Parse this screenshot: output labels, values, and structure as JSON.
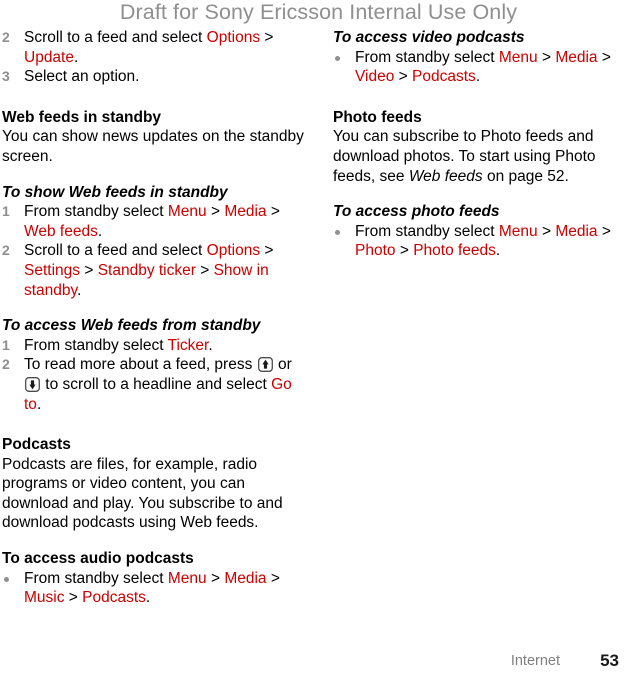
{
  "watermark": "Draft for Sony Ericsson Internal Use Only",
  "colors": {
    "ui_red": "#cc0000",
    "watermark_gray": "#8f8f8f",
    "marker_gray": "#8f8f8f",
    "footer_label_gray": "#808080",
    "body_black": "#000000"
  },
  "left_column": {
    "steps_continued": [
      {
        "number": "2",
        "parts": [
          {
            "text": "Scroll to a feed and select ",
            "style": "plain"
          },
          {
            "text": "Options",
            "style": "ui"
          },
          {
            "text": " > ",
            "style": "plain"
          },
          {
            "text": "Update",
            "style": "ui"
          },
          {
            "text": ".",
            "style": "plain"
          }
        ]
      },
      {
        "number": "3",
        "parts": [
          {
            "text": "Select an option.",
            "style": "plain"
          }
        ]
      }
    ],
    "section_web_feeds": {
      "heading": "Web feeds in standby",
      "body": "You can show news updates on the standby screen."
    },
    "task_show_web_feeds": {
      "heading": "To show Web feeds in standby",
      "steps": [
        {
          "number": "1",
          "parts": [
            {
              "text": "From standby select ",
              "style": "plain"
            },
            {
              "text": "Menu",
              "style": "ui"
            },
            {
              "text": " > ",
              "style": "plain"
            },
            {
              "text": "Media",
              "style": "ui"
            },
            {
              "text": " > ",
              "style": "plain"
            },
            {
              "text": "Web feeds",
              "style": "ui"
            },
            {
              "text": ".",
              "style": "plain"
            }
          ]
        },
        {
          "number": "2",
          "parts": [
            {
              "text": "Scroll to a feed and select ",
              "style": "plain"
            },
            {
              "text": "Options",
              "style": "ui"
            },
            {
              "text": " > ",
              "style": "plain"
            },
            {
              "text": "Settings",
              "style": "ui"
            },
            {
              "text": " > ",
              "style": "plain"
            },
            {
              "text": "Standby ticker",
              "style": "ui"
            },
            {
              "text": " > ",
              "style": "plain"
            },
            {
              "text": "Show in standby",
              "style": "ui"
            },
            {
              "text": ".",
              "style": "plain"
            }
          ]
        }
      ]
    },
    "task_access_web_feeds": {
      "heading": "To access Web feeds from standby",
      "step1": {
        "number": "1",
        "parts": [
          {
            "text": "From standby select ",
            "style": "plain"
          },
          {
            "text": "Ticker",
            "style": "ui"
          },
          {
            "text": ".",
            "style": "plain"
          }
        ]
      },
      "step2": {
        "number": "2",
        "text_a": "To read more about a feed, press ",
        "icon_up": "nav-key-up-icon",
        "text_b": " or ",
        "icon_down": "nav-key-down-icon",
        "text_c": " to scroll to a headline and select ",
        "link": "Go to",
        "text_d": "."
      }
    },
    "section_podcasts": {
      "heading": "Podcasts",
      "body": "Podcasts are files, for example, radio programs or video content, you can download and play. You subscribe to and download podcasts using Web feeds."
    },
    "task_audio_podcasts": {
      "heading": "To access audio podcasts",
      "bullet": {
        "parts": [
          {
            "text": "From standby select ",
            "style": "plain"
          },
          {
            "text": "Menu",
            "style": "ui"
          },
          {
            "text": " > ",
            "style": "plain"
          },
          {
            "text": "Media",
            "style": "ui"
          },
          {
            "text": " > ",
            "style": "plain"
          },
          {
            "text": "Music",
            "style": "ui"
          },
          {
            "text": " > ",
            "style": "plain"
          },
          {
            "text": "Podcasts",
            "style": "ui"
          },
          {
            "text": ".",
            "style": "plain"
          }
        ]
      }
    }
  },
  "right_column": {
    "task_video_podcasts": {
      "heading": "To access video podcasts",
      "bullet": {
        "parts": [
          {
            "text": "From standby select ",
            "style": "plain"
          },
          {
            "text": "Menu",
            "style": "ui"
          },
          {
            "text": " > ",
            "style": "plain"
          },
          {
            "text": "Media",
            "style": "ui"
          },
          {
            "text": " > ",
            "style": "plain"
          },
          {
            "text": "Video",
            "style": "ui"
          },
          {
            "text": " > ",
            "style": "plain"
          },
          {
            "text": "Podcasts",
            "style": "ui"
          },
          {
            "text": ".",
            "style": "plain"
          }
        ]
      }
    },
    "section_photo_feeds": {
      "heading": "Photo feeds",
      "body_a": "You can subscribe to Photo feeds and download photos. To start using Photo feeds, see ",
      "body_italic": "Web feeds",
      "body_b": " on page 52."
    },
    "task_photo_feeds": {
      "heading": "To access photo feeds",
      "bullet": {
        "parts": [
          {
            "text": "From standby select ",
            "style": "plain"
          },
          {
            "text": "Menu",
            "style": "ui"
          },
          {
            "text": " > ",
            "style": "plain"
          },
          {
            "text": "Media",
            "style": "ui"
          },
          {
            "text": " > ",
            "style": "plain"
          },
          {
            "text": "Photo",
            "style": "ui"
          },
          {
            "text": " > ",
            "style": "plain"
          },
          {
            "text": "Photo feeds",
            "style": "ui"
          },
          {
            "text": ".",
            "style": "plain"
          }
        ]
      }
    }
  },
  "footer": {
    "label": "Internet",
    "page_number": "53"
  }
}
